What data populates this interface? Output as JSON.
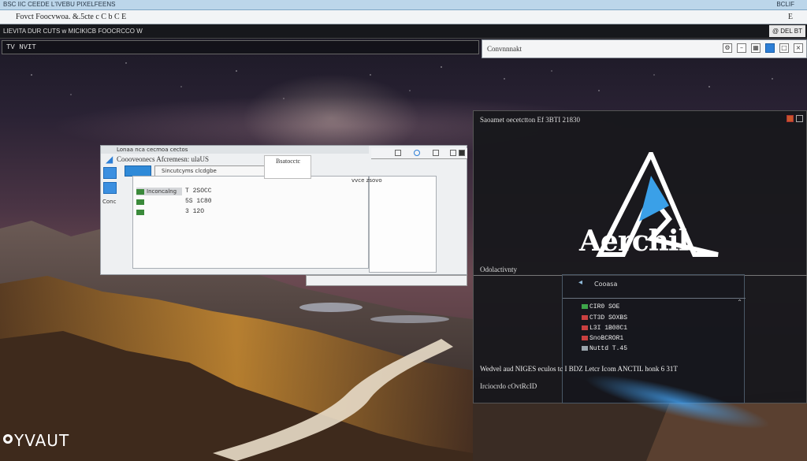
{
  "window": {
    "title": "BSC IIC CEEDE    L'IVEBU PIXELFEENS",
    "title_right": "BCLIF",
    "menu_text": "Fovct  Foocvwoa. &.5cte c    C    b    C    E",
    "menu_right": "E",
    "toolbar_text": "LIEVITA DUR  CUTS  w  MICIKICB  FOOCRCCO  W",
    "toolbar_right": "@ DEL BT",
    "address": "TV NVIT"
  },
  "search": {
    "label": "Convnnnakt"
  },
  "file_manager": {
    "title": "Lonaa nca cecmoa cectos",
    "path_label": "Coooveonecs  Afcremesn: ulaUS",
    "tab_label": "Sincutcyms clcdgbe",
    "side_label": "Conc",
    "tooltip": "Bsatocctc",
    "rows": [
      {
        "name": "Inconcalng",
        "size": "T 2SOCC"
      },
      {
        "name": "",
        "size": "5S 1C80"
      },
      {
        "name": "",
        "size": "3   12O"
      }
    ],
    "right_col": "vvce zsovo"
  },
  "installer": {
    "title": "Saoamet oecetctton  Ef 3BTI 21830",
    "logo_text": "Aerchil",
    "section_label": "Odolactivnty",
    "panel_head": "Cooasa",
    "items": [
      {
        "text": "CIR0 SOE",
        "color": "#3ea64a"
      },
      {
        "text": "CT3D SOXBS",
        "color": "#c94040"
      },
      {
        "text": "L3I 1B08C1",
        "color": "#c94040"
      },
      {
        "text": "SnoBCROR1",
        "color": "#c94040"
      },
      {
        "text": "Nuttd  T.45",
        "color": "#9aa5ad"
      }
    ],
    "status": "Wedvel  aud  NIGES eculos   tc   I BDZ  Letcr  Icom   ANCTIL honk 6  31T",
    "status2": "Irciocrdo     cOvtRcID"
  },
  "desktop": {
    "logo_text": "YVAUT"
  }
}
